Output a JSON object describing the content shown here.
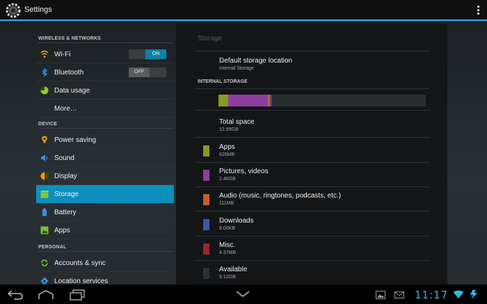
{
  "actionbar": {
    "title": "Settings",
    "app_icon": "settings-gear-icon",
    "overflow_icon": "overflow-menu-icon"
  },
  "sidebar": {
    "sections": [
      {
        "header": "WIRELESS & NETWORKS"
      },
      {
        "header": "DEVICE"
      },
      {
        "header": "PERSONAL"
      }
    ],
    "items": [
      {
        "label": "Wi-Fi",
        "icon": "wifi-icon",
        "toggle": "ON"
      },
      {
        "label": "Bluetooth",
        "icon": "bluetooth-icon",
        "toggle": "OFF"
      },
      {
        "label": "Data usage",
        "icon": "data-usage-icon"
      },
      {
        "label": "More…",
        "icon": ""
      },
      {
        "label": "Power saving",
        "icon": "power-saving-icon"
      },
      {
        "label": "Sound",
        "icon": "sound-icon"
      },
      {
        "label": "Display",
        "icon": "display-icon"
      },
      {
        "label": "Storage",
        "icon": "storage-icon",
        "selected": true
      },
      {
        "label": "Battery",
        "icon": "battery-icon"
      },
      {
        "label": "Apps",
        "icon": "apps-icon"
      },
      {
        "label": "Accounts & sync",
        "icon": "sync-icon"
      },
      {
        "label": "Location services",
        "icon": "location-icon"
      }
    ]
  },
  "storage": {
    "title": "Storage",
    "default_location": {
      "label": "Default storage location",
      "value": "Internal Storage"
    },
    "internal_header": "INTERNAL STORAGE",
    "total": {
      "label": "Total space",
      "value": "12.99GB"
    },
    "categories": [
      {
        "label": "Apps",
        "value": "626MB",
        "color": "#8a9a1e"
      },
      {
        "label": "Pictures, videos",
        "value": "2.46GB",
        "color": "#8e3ea0"
      },
      {
        "label": "Audio (music, ringtones, podcasts, etc.)",
        "value": "111MB",
        "color": "#c2632a"
      },
      {
        "label": "Downloads",
        "value": "8.00KB",
        "color": "#3a5aa6"
      },
      {
        "label": "Misc.",
        "value": "4.37MB",
        "color": "#962a2a"
      },
      {
        "label": "Available",
        "value": "9.12GB",
        "color": "#2f3235"
      }
    ]
  },
  "navbar": {
    "time": "11:17",
    "buttons": [
      "back-icon",
      "home-icon",
      "recent-apps-icon",
      "menu-chevron-icon"
    ],
    "status_icons": [
      "gallery-notification-icon",
      "mail-notification-icon",
      "wifi-signal-icon",
      "battery-status-icon"
    ],
    "accent": "#33b5e5"
  }
}
